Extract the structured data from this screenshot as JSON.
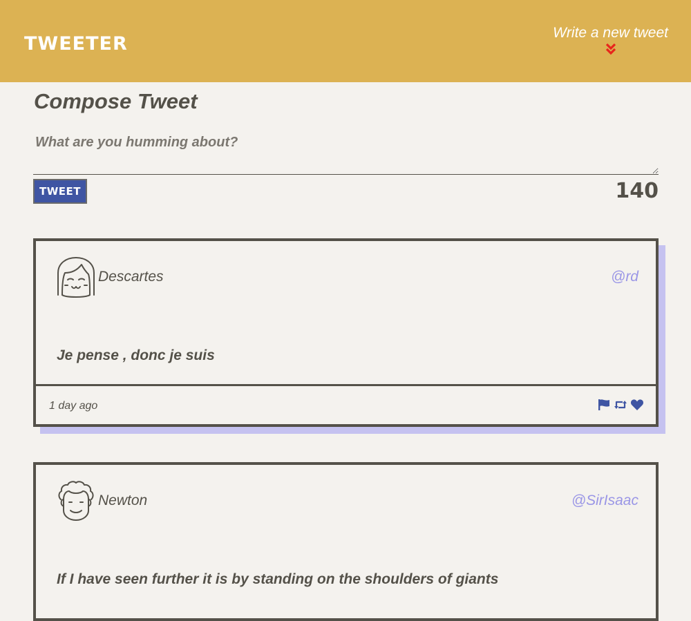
{
  "nav": {
    "brand": "Tweeter",
    "compose_link": "Write a new tweet",
    "compose_icon": "double-chevron-down-icon"
  },
  "compose": {
    "title": "Compose Tweet",
    "placeholder": "What are you humming about?",
    "value": "",
    "submit_label": "Tweet",
    "counter": "140"
  },
  "tweets": [
    {
      "avatar": "girl-face-icon",
      "name": "Descartes",
      "handle": "@rd",
      "content": "Je pense , donc je suis",
      "time": "1 day ago",
      "actions": [
        "flag-icon",
        "retweet-icon",
        "heart-icon"
      ]
    },
    {
      "avatar": "curly-hair-face-icon",
      "name": "Newton",
      "handle": "@SirIsaac",
      "content": "If I have seen further it is by standing on the shoulders of giants",
      "time": "",
      "actions": []
    }
  ],
  "colors": {
    "header": "#dcb253",
    "background": "#f4f2ee",
    "text": "#545149",
    "accent": "#3f55a3",
    "handle": "#9a96e6",
    "shadow": "#c5c2f0",
    "chevron": "#e8251c"
  }
}
